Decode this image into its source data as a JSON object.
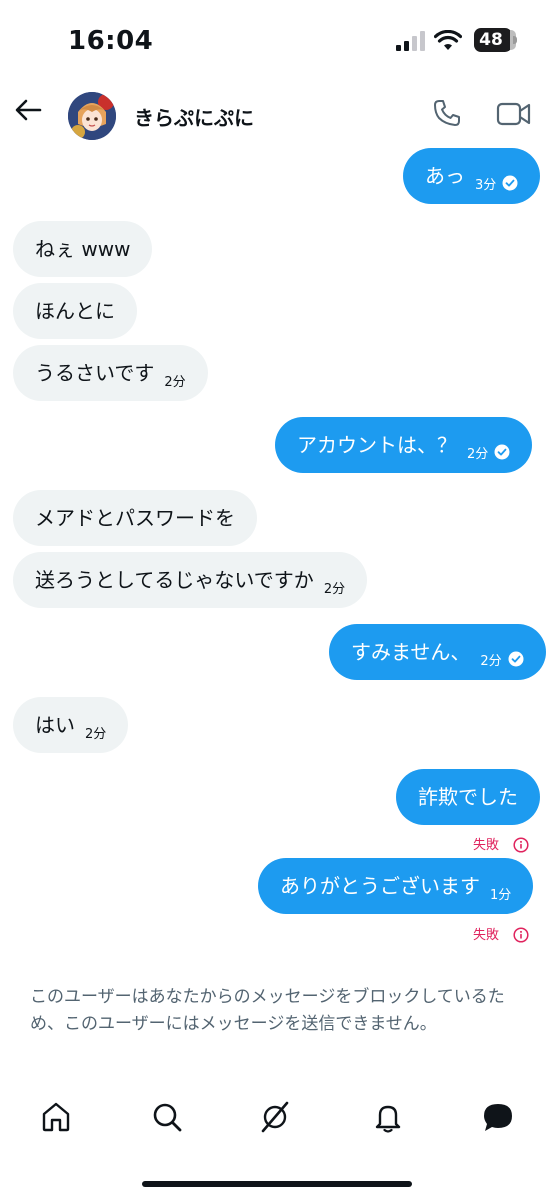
{
  "status_bar": {
    "time": "16:04",
    "battery": "48"
  },
  "header": {
    "contact_name": "きらぷにぷに"
  },
  "messages": [
    {
      "text": "あっ",
      "time": "3分"
    },
    {
      "text": "ねぇ www"
    },
    {
      "text": "ほんとに"
    },
    {
      "text": "うるさいです",
      "time": "2分"
    },
    {
      "text": "アカウントは、？",
      "time": "2分"
    },
    {
      "text": "メアドとパスワードを"
    },
    {
      "text": "送ろうとしてるじゃないですか",
      "time": "2分"
    },
    {
      "text": "すみません、",
      "time": "2分"
    },
    {
      "text": "はい",
      "time": "2分"
    },
    {
      "text": "詐欺でした",
      "status": "失敗"
    },
    {
      "text": "ありがとうございます",
      "time": "1分",
      "status": "失敗"
    }
  ],
  "blocked_notice": "このユーザーはあなたからのメッセージをブロックしているため、このユーザーにはメッセージを送信できません。",
  "nav": [
    "home-icon",
    "search-icon",
    "grok-icon",
    "notifications-icon",
    "messages-icon"
  ],
  "colors": {
    "accent": "#1d9bf0",
    "incoming_bubble": "#eff3f4",
    "error": "#e0245e",
    "muted": "#536471"
  }
}
